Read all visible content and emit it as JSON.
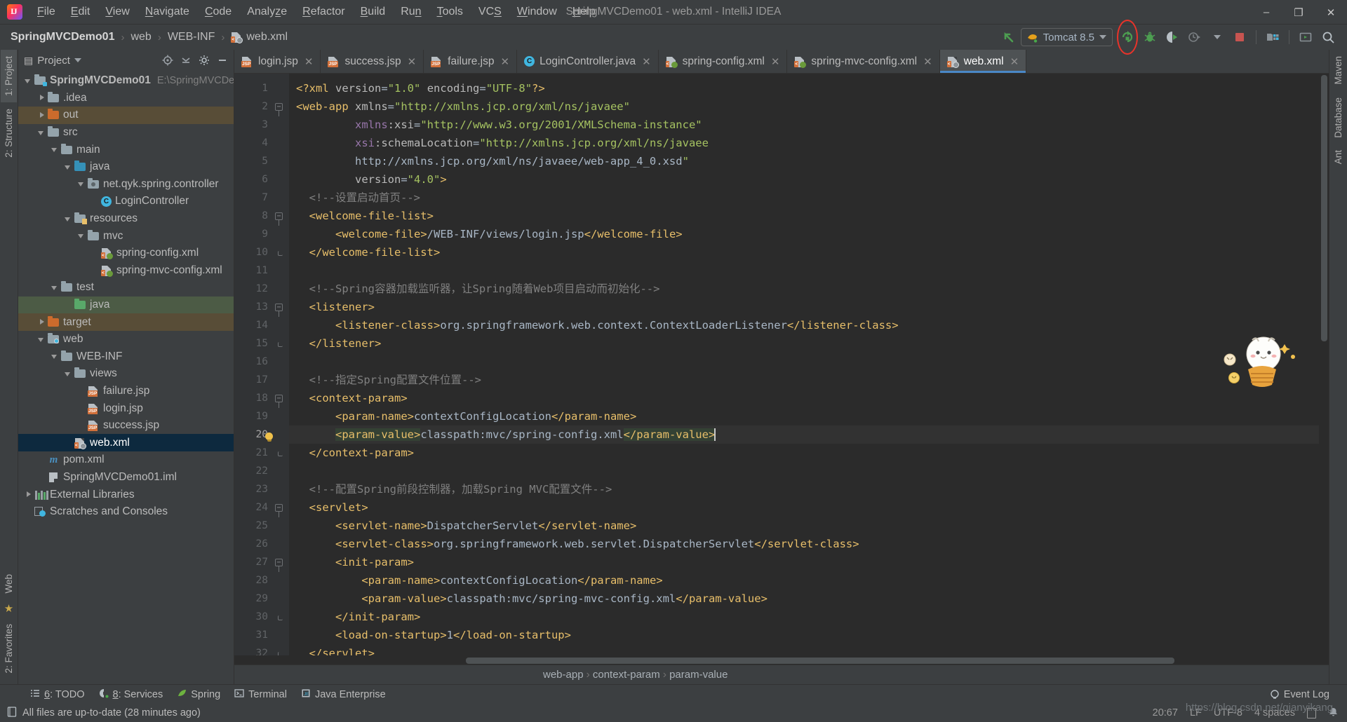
{
  "window": {
    "title": "SpringMVCDemo01 - web.xml - IntelliJ IDEA",
    "minimize": "–",
    "maximize": "❐",
    "close": "✕"
  },
  "menu": [
    {
      "label": "File",
      "mnemonic": "F"
    },
    {
      "label": "Edit",
      "mnemonic": "E"
    },
    {
      "label": "View",
      "mnemonic": "V"
    },
    {
      "label": "Navigate",
      "mnemonic": "N"
    },
    {
      "label": "Code",
      "mnemonic": "C"
    },
    {
      "label": "Analyze",
      "mnemonic": "z"
    },
    {
      "label": "Refactor",
      "mnemonic": "R"
    },
    {
      "label": "Build",
      "mnemonic": "B"
    },
    {
      "label": "Run",
      "mnemonic": "n"
    },
    {
      "label": "Tools",
      "mnemonic": "T"
    },
    {
      "label": "VCS",
      "mnemonic": "S"
    },
    {
      "label": "Window",
      "mnemonic": "W"
    },
    {
      "label": "Help",
      "mnemonic": "H"
    }
  ],
  "navbar": {
    "crumbs": [
      "SpringMVCDemo01",
      "web",
      "WEB-INF",
      "web.xml"
    ],
    "separator": "›"
  },
  "toolbar": {
    "run_config": "Tomcat 8.5",
    "icons": [
      "rerun-icon",
      "debug-icon",
      "run-with-coverage-icon",
      "profiler-icon",
      "stop-icon",
      "project-structure-icon",
      "terminal-icon",
      "search-everywhere-icon"
    ],
    "highlight_color": "#e8332a"
  },
  "left_strip": {
    "tabs": [
      "1: Project",
      "2: Structure",
      "2: Favorites",
      "Web"
    ]
  },
  "right_strip": {
    "tabs": [
      "Maven",
      "Database",
      "Ant"
    ]
  },
  "project_panel": {
    "title": "Project",
    "header_icons": [
      "target-icon",
      "collapse-all-icon",
      "settings-gear-icon",
      "hide-icon"
    ],
    "tree": [
      {
        "label": "SpringMVCDemo01",
        "sub": "E:\\SpringMVCDem",
        "depth": 0,
        "arrow": "down",
        "icon": "module-folder-icon",
        "state": "normal",
        "bold": true
      },
      {
        "label": ".idea",
        "sub": "",
        "depth": 1,
        "arrow": "right",
        "icon": "folder-icon",
        "state": "normal",
        "bold": false
      },
      {
        "label": "out",
        "sub": "",
        "depth": 1,
        "arrow": "right",
        "icon": "folder-orange-icon",
        "state": "excluded",
        "bold": false
      },
      {
        "label": "src",
        "sub": "",
        "depth": 1,
        "arrow": "down",
        "icon": "folder-icon",
        "state": "normal",
        "bold": false
      },
      {
        "label": "main",
        "sub": "",
        "depth": 2,
        "arrow": "down",
        "icon": "folder-icon",
        "state": "normal",
        "bold": false
      },
      {
        "label": "java",
        "sub": "",
        "depth": 3,
        "arrow": "down",
        "icon": "folder-blue-icon",
        "state": "normal",
        "bold": false
      },
      {
        "label": "net.qyk.spring.controller",
        "sub": "",
        "depth": 4,
        "arrow": "down",
        "icon": "package-icon",
        "state": "normal",
        "bold": false
      },
      {
        "label": "LoginController",
        "sub": "",
        "depth": 5,
        "arrow": "none",
        "icon": "java-class-icon",
        "state": "normal",
        "bold": false
      },
      {
        "label": "resources",
        "sub": "",
        "depth": 3,
        "arrow": "down",
        "icon": "resources-folder-icon",
        "state": "normal",
        "bold": false
      },
      {
        "label": "mvc",
        "sub": "",
        "depth": 4,
        "arrow": "down",
        "icon": "folder-icon",
        "state": "normal",
        "bold": false
      },
      {
        "label": "spring-config.xml",
        "sub": "",
        "depth": 5,
        "arrow": "none",
        "icon": "spring-xml-icon",
        "state": "normal",
        "bold": false
      },
      {
        "label": "spring-mvc-config.xml",
        "sub": "",
        "depth": 5,
        "arrow": "none",
        "icon": "spring-xml-icon",
        "state": "normal",
        "bold": false
      },
      {
        "label": "test",
        "sub": "",
        "depth": 2,
        "arrow": "down",
        "icon": "folder-icon",
        "state": "normal",
        "bold": false
      },
      {
        "label": "java",
        "sub": "",
        "depth": 3,
        "arrow": "none",
        "icon": "folder-green-icon",
        "state": "test-source",
        "bold": false
      },
      {
        "label": "target",
        "sub": "",
        "depth": 1,
        "arrow": "right",
        "icon": "folder-orange-icon",
        "state": "excluded",
        "bold": false
      },
      {
        "label": "web",
        "sub": "",
        "depth": 1,
        "arrow": "down",
        "icon": "web-folder-icon",
        "state": "normal",
        "bold": false
      },
      {
        "label": "WEB-INF",
        "sub": "",
        "depth": 2,
        "arrow": "down",
        "icon": "folder-icon",
        "state": "normal",
        "bold": false
      },
      {
        "label": "views",
        "sub": "",
        "depth": 3,
        "arrow": "down",
        "icon": "folder-icon",
        "state": "normal",
        "bold": false
      },
      {
        "label": "failure.jsp",
        "sub": "",
        "depth": 4,
        "arrow": "none",
        "icon": "jsp-file-icon",
        "state": "normal",
        "bold": false
      },
      {
        "label": "login.jsp",
        "sub": "",
        "depth": 4,
        "arrow": "none",
        "icon": "jsp-file-icon",
        "state": "normal",
        "bold": false
      },
      {
        "label": "success.jsp",
        "sub": "",
        "depth": 4,
        "arrow": "none",
        "icon": "jsp-file-icon",
        "state": "normal",
        "bold": false
      },
      {
        "label": "web.xml",
        "sub": "",
        "depth": 3,
        "arrow": "none",
        "icon": "webxml-file-icon",
        "state": "selected",
        "bold": false
      },
      {
        "label": "pom.xml",
        "sub": "",
        "depth": 1,
        "arrow": "none",
        "icon": "maven-pom-icon",
        "state": "normal",
        "bold": false
      },
      {
        "label": "SpringMVCDemo01.iml",
        "sub": "",
        "depth": 1,
        "arrow": "none",
        "icon": "iml-file-icon",
        "state": "normal",
        "bold": false
      },
      {
        "label": "External Libraries",
        "sub": "",
        "depth": 0,
        "arrow": "right",
        "icon": "libraries-icon",
        "state": "normal",
        "bold": false
      },
      {
        "label": "Scratches and Consoles",
        "sub": "",
        "depth": 0,
        "arrow": "none",
        "icon": "scratches-icon",
        "state": "normal",
        "bold": false
      }
    ]
  },
  "editor": {
    "tabs": [
      {
        "label": "login.jsp",
        "icon": "jsp-file-icon",
        "active": false
      },
      {
        "label": "success.jsp",
        "icon": "jsp-file-icon",
        "active": false
      },
      {
        "label": "failure.jsp",
        "icon": "jsp-file-icon",
        "active": false
      },
      {
        "label": "LoginController.java",
        "icon": "java-class-icon",
        "active": false
      },
      {
        "label": "spring-config.xml",
        "icon": "spring-xml-icon",
        "active": false
      },
      {
        "label": "spring-mvc-config.xml",
        "icon": "spring-xml-icon",
        "active": false
      },
      {
        "label": "web.xml",
        "icon": "webxml-file-icon",
        "active": true
      }
    ],
    "tab_close": "✕",
    "current_line": 20,
    "lines": [
      {
        "n": 1,
        "fold": "none"
      },
      {
        "n": 2,
        "fold": "start"
      },
      {
        "n": 3,
        "fold": "none"
      },
      {
        "n": 4,
        "fold": "none"
      },
      {
        "n": 5,
        "fold": "none"
      },
      {
        "n": 6,
        "fold": "none"
      },
      {
        "n": 7,
        "fold": "none"
      },
      {
        "n": 8,
        "fold": "start"
      },
      {
        "n": 9,
        "fold": "none"
      },
      {
        "n": 10,
        "fold": "end"
      },
      {
        "n": 11,
        "fold": "none"
      },
      {
        "n": 12,
        "fold": "none"
      },
      {
        "n": 13,
        "fold": "start"
      },
      {
        "n": 14,
        "fold": "none"
      },
      {
        "n": 15,
        "fold": "end"
      },
      {
        "n": 16,
        "fold": "none"
      },
      {
        "n": 17,
        "fold": "none"
      },
      {
        "n": 18,
        "fold": "start"
      },
      {
        "n": 19,
        "fold": "none"
      },
      {
        "n": 20,
        "fold": "none",
        "bulb": true
      },
      {
        "n": 21,
        "fold": "end"
      },
      {
        "n": 22,
        "fold": "none"
      },
      {
        "n": 23,
        "fold": "none"
      },
      {
        "n": 24,
        "fold": "start"
      },
      {
        "n": 25,
        "fold": "none"
      },
      {
        "n": 26,
        "fold": "none"
      },
      {
        "n": 27,
        "fold": "start"
      },
      {
        "n": 28,
        "fold": "none"
      },
      {
        "n": 29,
        "fold": "none"
      },
      {
        "n": 30,
        "fold": "end"
      },
      {
        "n": 31,
        "fold": "none"
      },
      {
        "n": 32,
        "fold": "end"
      }
    ],
    "code_text": [
      "<?xml version=\"1.0\" encoding=\"UTF-8\"?>",
      "<web-app xmlns=\"http://xmlns.jcp.org/xml/ns/javaee\"",
      "         xmlns:xsi=\"http://www.w3.org/2001/XMLSchema-instance\"",
      "         xsi:schemaLocation=\"http://xmlns.jcp.org/xml/ns/javaee",
      "         http://xmlns.jcp.org/xml/ns/javaee/web-app_4_0.xsd\"",
      "         version=\"4.0\">",
      "  <!--设置启动首页-->",
      "  <welcome-file-list>",
      "      <welcome-file>/WEB-INF/views/login.jsp</welcome-file>",
      "  </welcome-file-list>",
      "",
      "  <!--Spring容器加载监听器，让Spring随着Web项目启动而初始化-->",
      "  <listener>",
      "      <listener-class>org.springframework.web.context.ContextLoaderListener</listener-class>",
      "  </listener>",
      "",
      "  <!--指定Spring配置文件位置-->",
      "  <context-param>",
      "      <param-name>contextConfigLocation</param-name>",
      "      <param-value>classpath:mvc/spring-config.xml</param-value>",
      "  </context-param>",
      "",
      "  <!--配置Spring前段控制器，加载Spring MVC配置文件-->",
      "  <servlet>",
      "      <servlet-name>DispatcherServlet</servlet-name>",
      "      <servlet-class>org.springframework.web.servlet.DispatcherServlet</servlet-class>",
      "      <init-param>",
      "          <param-name>contextConfigLocation</param-name>",
      "          <param-value>classpath:mvc/spring-mvc-config.xml</param-value>",
      "      </init-param>",
      "      <load-on-startup>1</load-on-startup>",
      "  </servlet>"
    ],
    "breadcrumb": [
      "web-app",
      "context-param",
      "param-value"
    ],
    "breadcrumb_sep": "›"
  },
  "tool_windows": [
    {
      "label": "6: TODO",
      "num": "6",
      "rest": ": TODO",
      "icon": "todo-icon"
    },
    {
      "label": "8: Services",
      "num": "8",
      "rest": ": Services",
      "icon": "services-icon"
    },
    {
      "label": "Spring",
      "num": "",
      "rest": "Spring",
      "icon": "spring-leaf-icon"
    },
    {
      "label": "Terminal",
      "num": "",
      "rest": "Terminal",
      "icon": "terminal-icon"
    },
    {
      "label": "Java Enterprise",
      "num": "",
      "rest": "Java Enterprise",
      "icon": "java-enterprise-icon"
    }
  ],
  "event_log": "Event Log",
  "status": {
    "message": "All files are up-to-date (28 minutes ago)",
    "caret": "20:67",
    "line_sep": "LF",
    "encoding": "UTF-8",
    "indent": "4 spaces",
    "watermark": "https://blog.csdn.net/qianyikang"
  }
}
